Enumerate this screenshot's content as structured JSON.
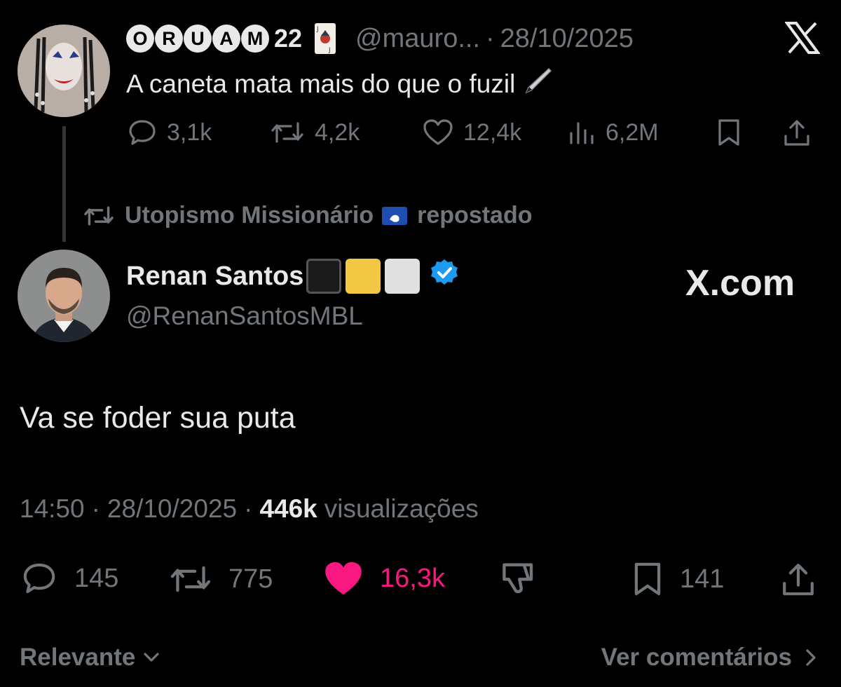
{
  "quoted_tweet": {
    "display_name_letters": [
      "O",
      "R",
      "U",
      "A",
      "M"
    ],
    "display_name_suffix": "22",
    "handle": "@mauro...",
    "separator": "·",
    "date": "28/10/2025",
    "text": "A caneta mata mais do que o fuzil",
    "stats": {
      "replies": "3,1k",
      "reposts": "4,2k",
      "likes": "12,4k",
      "views": "6,2M"
    },
    "icons": [
      "joker-card-icon",
      "x-logo-icon",
      "pen-icon",
      "reply-icon",
      "repost-icon",
      "like-icon",
      "views-icon",
      "bookmark-icon",
      "share-icon"
    ]
  },
  "repost_banner": {
    "user": "Utopismo Missionário",
    "suffix": "repostado",
    "icons": [
      "repost-icon",
      "flag-icon"
    ]
  },
  "main_tweet": {
    "display_name": "Renan Santos",
    "handle": "@RenanSantosMBL",
    "brand": "X.com",
    "text": "Va se foder sua puta",
    "time": "14:50",
    "separator": "·",
    "date": "28/10/2025",
    "views_count": "446k",
    "views_label": "visualizações",
    "stats": {
      "replies": "145",
      "reposts": "775",
      "likes": "16,3k",
      "bookmarks": "141"
    },
    "colors": {
      "like_active": "#f91880",
      "verified": "#1d9bf0",
      "black_square": "#1a1a1a",
      "yellow_square": "#f2c744",
      "white_square": "#e0e0e0"
    },
    "icons": [
      "verified-badge-icon",
      "reply-icon",
      "repost-icon",
      "heart-filled-icon",
      "dislike-icon",
      "bookmark-icon",
      "share-icon"
    ]
  },
  "footer": {
    "sort_label": "Relevante",
    "comments_link": "Ver comentários"
  }
}
